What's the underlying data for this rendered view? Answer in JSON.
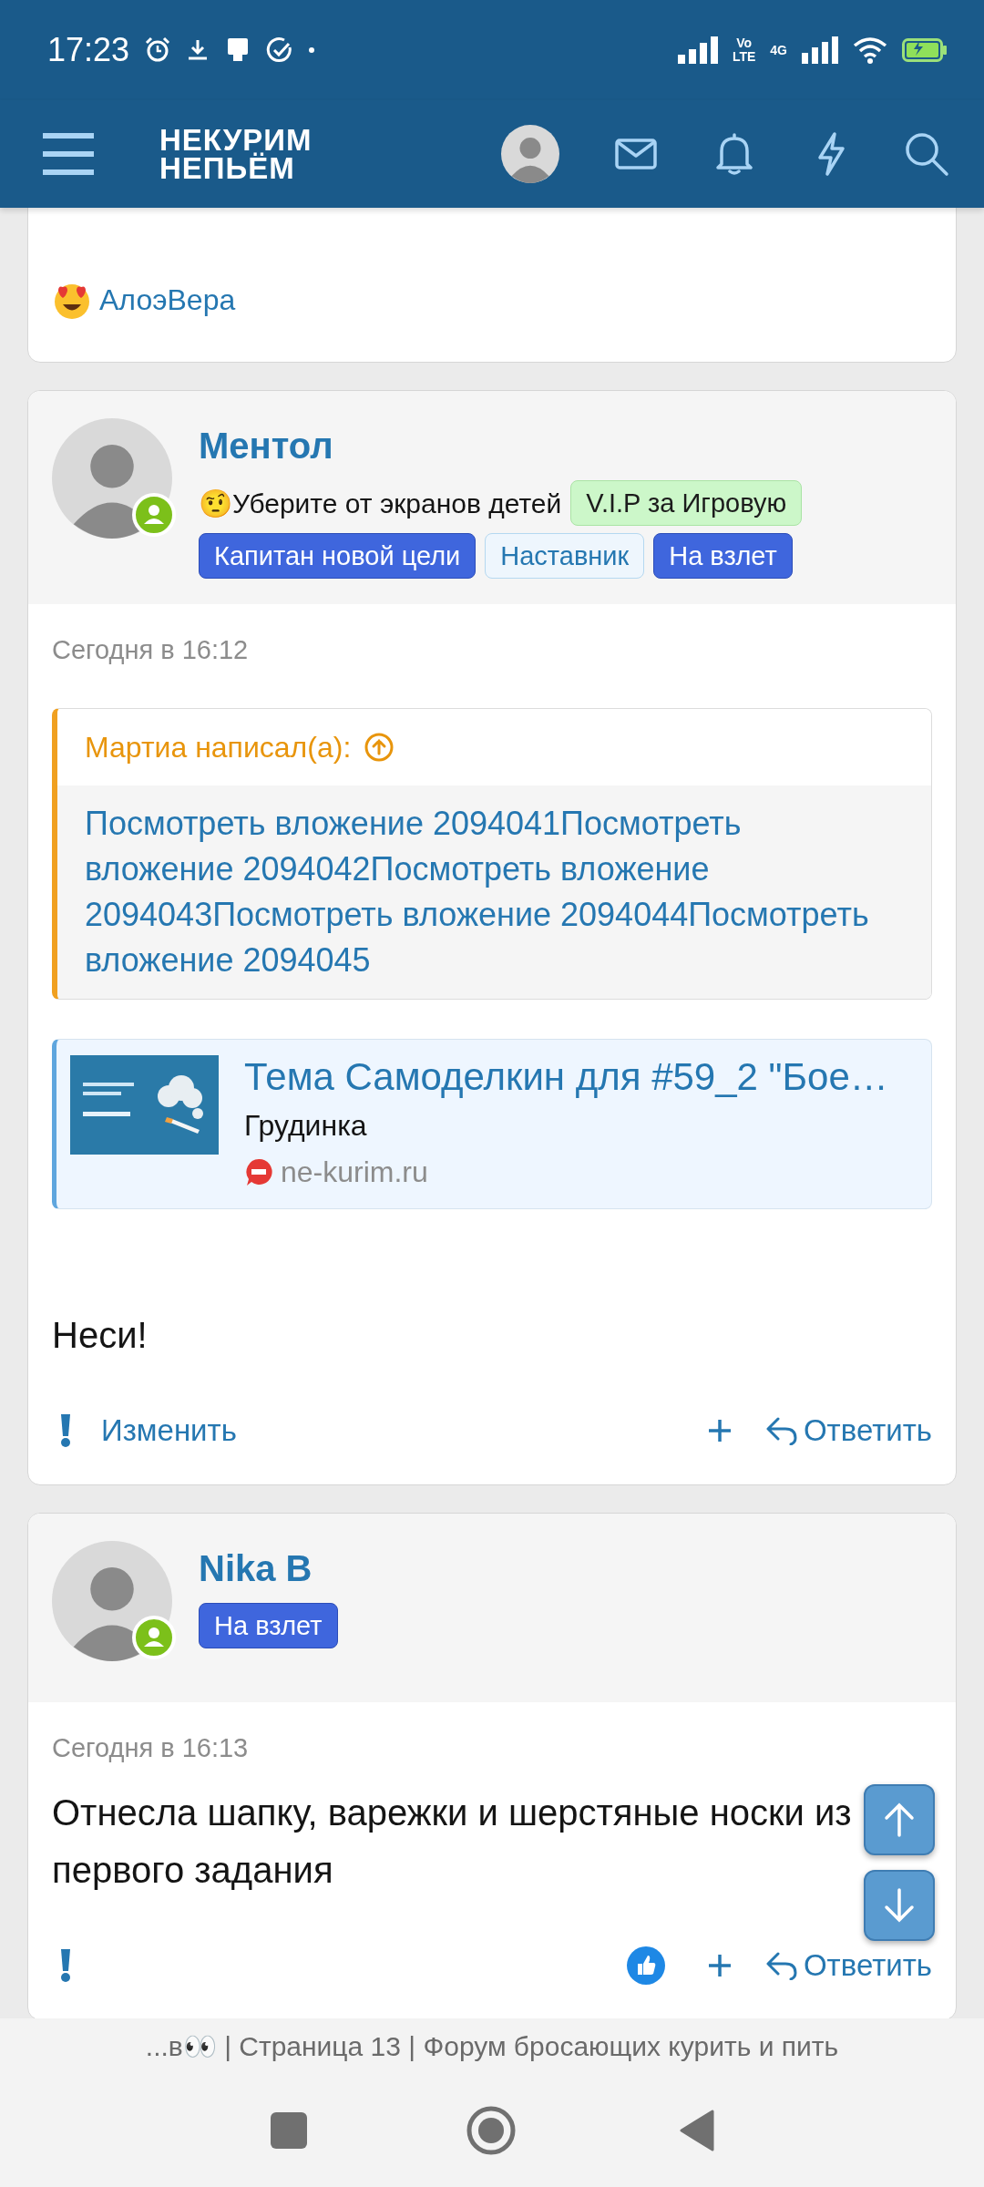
{
  "status_bar": {
    "time": "17:23",
    "volte_top": "Vo",
    "volte_bottom": "LTE",
    "network": "4G",
    "charging": true
  },
  "header": {
    "logo_lines": [
      "НЕКУРИМ",
      "НЕПЬЁМ"
    ]
  },
  "posts": [
    {
      "reactions": {
        "names": "АлоэВера"
      }
    },
    {
      "author": {
        "name": "Ментол",
        "online": true,
        "status": "🤨Уберите от экранов детей",
        "badges": [
          {
            "text": "V.I.P за Игровую",
            "kind": "vip"
          },
          {
            "text": "Капитан новой цели",
            "kind": "primary"
          },
          {
            "text": "Наставник",
            "kind": "outline"
          },
          {
            "text": "На взлет",
            "kind": "primary"
          }
        ]
      },
      "date": "Сегодня в 16:12",
      "quote": {
        "author": "Мартиа написал(а):",
        "text": "Посмотреть вложение 2094041Посмотреть вложение 2094042Посмотреть вложение 2094043Посмотреть вложение 2094044Посмотреть вложение 2094045"
      },
      "link_preview": {
        "title": "Тема Самоделкин для #59_2 \"Бое…",
        "subtitle": "Грудинка",
        "site": "ne-kurim.ru"
      },
      "body": "Неси!",
      "actions": {
        "edit": "Изменить",
        "reply": "Ответить",
        "reacted": false
      }
    },
    {
      "author": {
        "name": "Nika B",
        "online": true,
        "badges": [
          {
            "text": "На взлет",
            "kind": "primary"
          }
        ]
      },
      "date": "Сегодня в 16:13",
      "body": "Отнесла шапку, варежки и шерстяные носки из первого задания",
      "actions": {
        "reply": "Ответить",
        "reacted": true
      }
    }
  ],
  "browser_title": "...в👀 | Страница 13 | Форум бросающих курить и пить"
}
